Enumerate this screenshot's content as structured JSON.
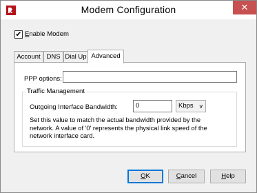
{
  "window": {
    "title": "Modem Configuration",
    "close_glyph": "✕",
    "app_icon": "watchguard-logo-icon"
  },
  "enable_modem": {
    "checked": true,
    "check_glyph": "✔",
    "label_mnemonic": "E",
    "label_rest": "nable Modem"
  },
  "tabs": [
    {
      "label": "Account",
      "active": false
    },
    {
      "label": "DNS",
      "active": false
    },
    {
      "label": "Dial Up",
      "active": false
    },
    {
      "label": "Advanced",
      "active": true
    }
  ],
  "advanced": {
    "ppp_options_label": "PPP options:",
    "ppp_options_value": "",
    "traffic_group_label": "Traffic Management",
    "bandwidth_label": "Outgoing Interface Bandwidth:",
    "bandwidth_value": "0",
    "unit_selected": "Kbps",
    "unit_chevron": "v",
    "help_line1": "Set this value to match the actual bandwidth provided by the",
    "help_line2": "network. A value of '0' represents the physical link speed of the",
    "help_line3": "network interface card."
  },
  "buttons": {
    "ok_mnemonic": "O",
    "ok_rest": "K",
    "cancel_mnemonic": "C",
    "cancel_rest": "ancel",
    "help_mnemonic": "H",
    "help_rest": "elp"
  },
  "colors": {
    "close_button": "#c75050",
    "default_button_border": "#0078d7"
  }
}
